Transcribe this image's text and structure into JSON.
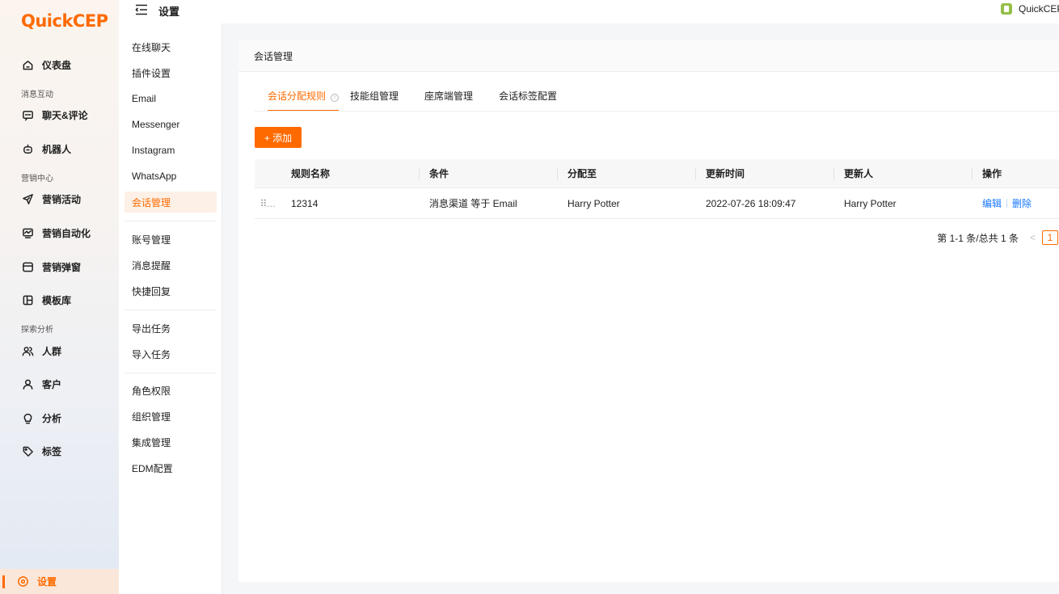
{
  "app": {
    "logo": "QuickCEP",
    "store_name": "QuickCEP"
  },
  "topbar": {
    "title": "设置"
  },
  "sidebar": {
    "dashboard": "仪表盘",
    "group_messaging": "消息互动",
    "chat": "聊天&评论",
    "robot": "机器人",
    "group_marketing": "营销中心",
    "campaigns": "营销活动",
    "automation": "营销自动化",
    "popups": "营销弹窗",
    "templates": "模板库",
    "group_analytics": "探索分析",
    "crowd": "人群",
    "customers": "客户",
    "analysis": "分析",
    "tags": "标签",
    "settings": "设置"
  },
  "submenu": {
    "items": [
      "在线聊天",
      "插件设置",
      "Email",
      "Messenger",
      "Instagram",
      "WhatsApp",
      "会话管理",
      "账号管理",
      "消息提醒",
      "快捷回复",
      "导出任务",
      "导入任务",
      "角色权限",
      "组织管理",
      "集成管理",
      "EDM配置"
    ],
    "active": "会话管理"
  },
  "card": {
    "title": "会话管理",
    "tabs": [
      "会话分配规则",
      "技能组管理",
      "座席端管理",
      "会话标签配置"
    ],
    "info_icon": "i",
    "add_button": "+ 添加"
  },
  "table": {
    "columns": [
      "规则名称",
      "条件",
      "分配至",
      "更新时间",
      "更新人",
      "操作"
    ],
    "drag_handle": "⠿…",
    "rows": [
      {
        "name": "12314",
        "condition": "消息渠道 等于 Email",
        "assignee": "Harry Potter",
        "updated_at": "2022-07-26 18:09:47",
        "updated_by": "Harry Potter",
        "edit": "编辑",
        "delete": "删除"
      }
    ]
  },
  "pagination": {
    "summary": "第 1-1 条/总共 1 条",
    "prev": "<",
    "current": "1"
  },
  "colors": {
    "accent": "#ff6a00",
    "link": "#1677ff"
  }
}
